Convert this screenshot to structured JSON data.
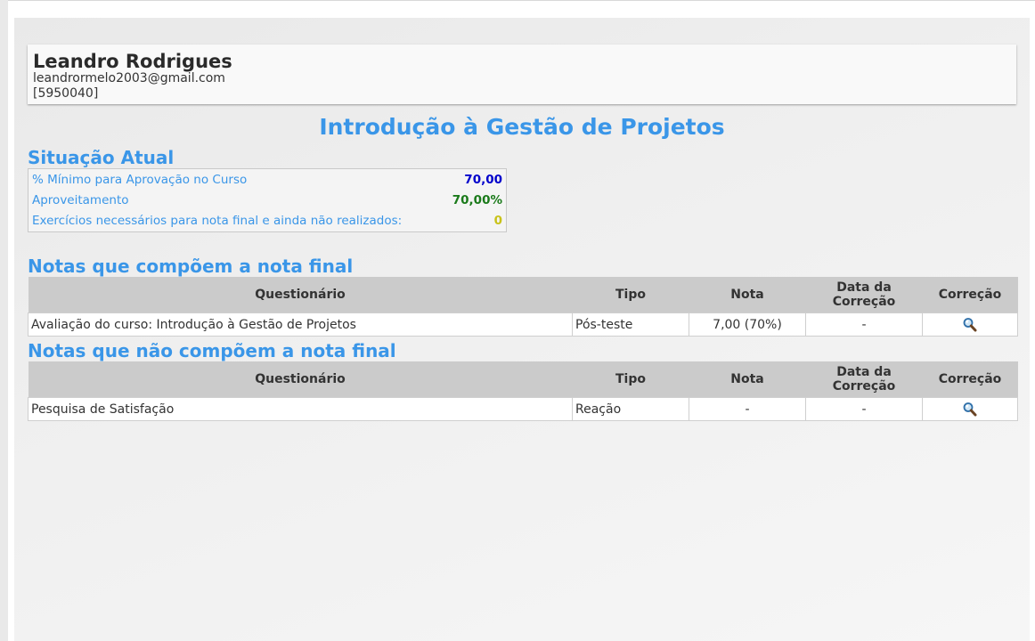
{
  "user": {
    "name": "Leandro Rodrigues",
    "email": "leandrormelo2003@gmail.com",
    "id": "[5950040]"
  },
  "course": {
    "title": "Introdução à Gestão de Projetos"
  },
  "status": {
    "title": "Situação Atual",
    "rows": [
      {
        "label": "% Mínimo para Aprovação no Curso",
        "value": "70,00",
        "color": "#0000cc"
      },
      {
        "label": "Aproveitamento",
        "value": "70,00%",
        "color": "#1a7a1a"
      },
      {
        "label": "Exercícios necessários para nota final e ainda não realizados:",
        "value": "0",
        "color": "#c8c21a"
      }
    ]
  },
  "columns": {
    "questionario": "Questionário",
    "tipo": "Tipo",
    "nota": "Nota",
    "data1": "Data da",
    "data2": "Correção",
    "correcao": "Correção"
  },
  "final_grades": {
    "title": "Notas que compõem a nota final",
    "rows": [
      {
        "questionario": "Avaliação do curso: Introdução à Gestão de Projetos",
        "tipo": "Pós-teste",
        "nota": "7,00 (70%)",
        "data": "-",
        "correcao_icon": "magnifier-icon"
      }
    ]
  },
  "other_grades": {
    "title": "Notas que não compõem a nota final",
    "rows": [
      {
        "questionario": "Pesquisa de Satisfação",
        "tipo": "Reação",
        "nota": "-",
        "data": "-",
        "correcao_icon": "magnifier-icon"
      }
    ]
  }
}
